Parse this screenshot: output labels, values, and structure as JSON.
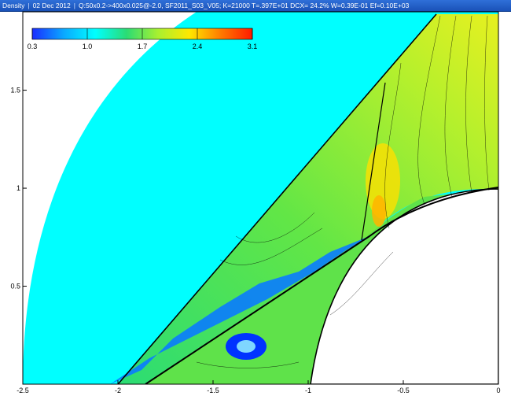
{
  "window": {
    "variable": "Density",
    "date": "02 Dec 2012",
    "info": "Q:50x0.2->400x0.025@-2.0, SF2011_S03_V05; K=21000 T=.397E+01 DCX= 24.2% W=0.39E-01 Ef=0.10E+03"
  },
  "chart_data": {
    "type": "heatmap",
    "title": "",
    "xlabel": "",
    "ylabel": "",
    "xlim": [
      -2.5,
      0
    ],
    "ylim": [
      0,
      1.9
    ],
    "x_ticks": [
      "-2.5",
      "-2",
      "-1.5",
      "-1",
      "-0.5",
      "0"
    ],
    "y_ticks": [
      "0.5",
      "1",
      "1.5"
    ],
    "colorbar": {
      "min": 0.3,
      "max": 3.1,
      "labels": [
        "0.3",
        "1.0",
        "1.7",
        "2.4",
        "3.1"
      ],
      "colors": [
        "#1a2cff",
        "#0aa8ff",
        "#00ffff",
        "#2bdc74",
        "#a8f030",
        "#ffe800",
        "#ff7a00",
        "#ff1a00"
      ]
    },
    "regions": {
      "freestream": 1.0,
      "shock_layer": 1.9,
      "hot_spot": 2.5,
      "separation_bubble": 0.6
    }
  }
}
